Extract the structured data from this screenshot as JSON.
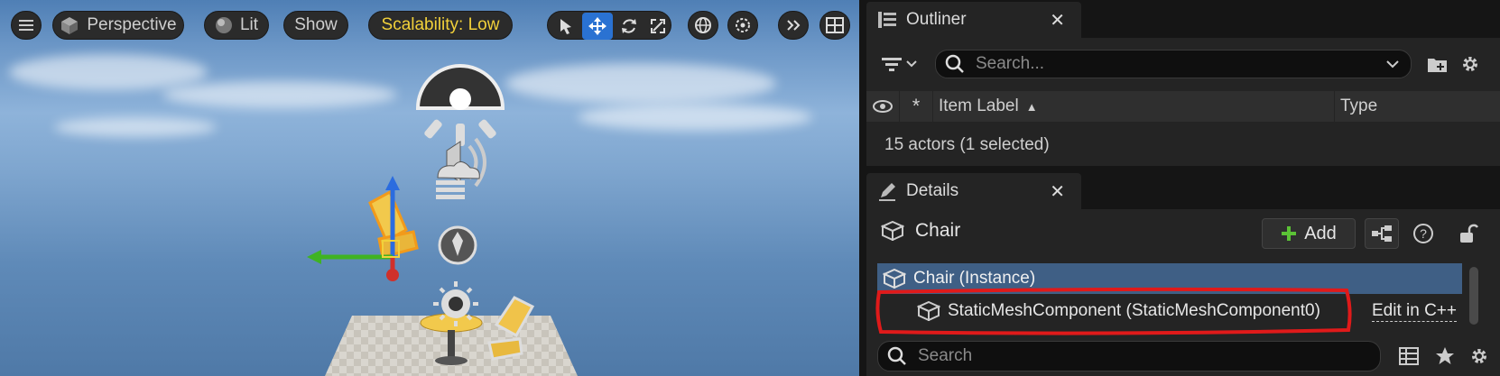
{
  "viewport": {
    "menu_icon": "hamburger-icon",
    "perspective_label": "Perspective",
    "lit_label": "Lit",
    "show_label": "Show",
    "scalability_label": "Scalability: Low",
    "tools": [
      "select-icon",
      "translate-icon",
      "rotate-icon",
      "scale-icon",
      "world-icon",
      "snap-icon",
      "more-icon",
      "layout-icon"
    ]
  },
  "outliner": {
    "tab_label": "Outliner",
    "search_placeholder": "Search...",
    "columns": {
      "label": "Item Label",
      "label_sort": "▲",
      "type": "Type"
    },
    "status": "15 actors (1 selected)"
  },
  "details": {
    "tab_label": "Details",
    "object_name": "Chair",
    "add_label": "Add",
    "tree": [
      {
        "label": "Chair (Instance)",
        "selected": true
      },
      {
        "label": "StaticMeshComponent (StaticMeshComponent0)",
        "selected": false,
        "action": "Edit in C++"
      }
    ],
    "search_placeholder": "Search"
  },
  "colors": {
    "accent_blue": "#2a72d2",
    "highlight_yellow": "#f2d13a",
    "selection_row": "#3f5f85",
    "annotation_red": "#e01a1a",
    "add_green": "#5bc236"
  }
}
